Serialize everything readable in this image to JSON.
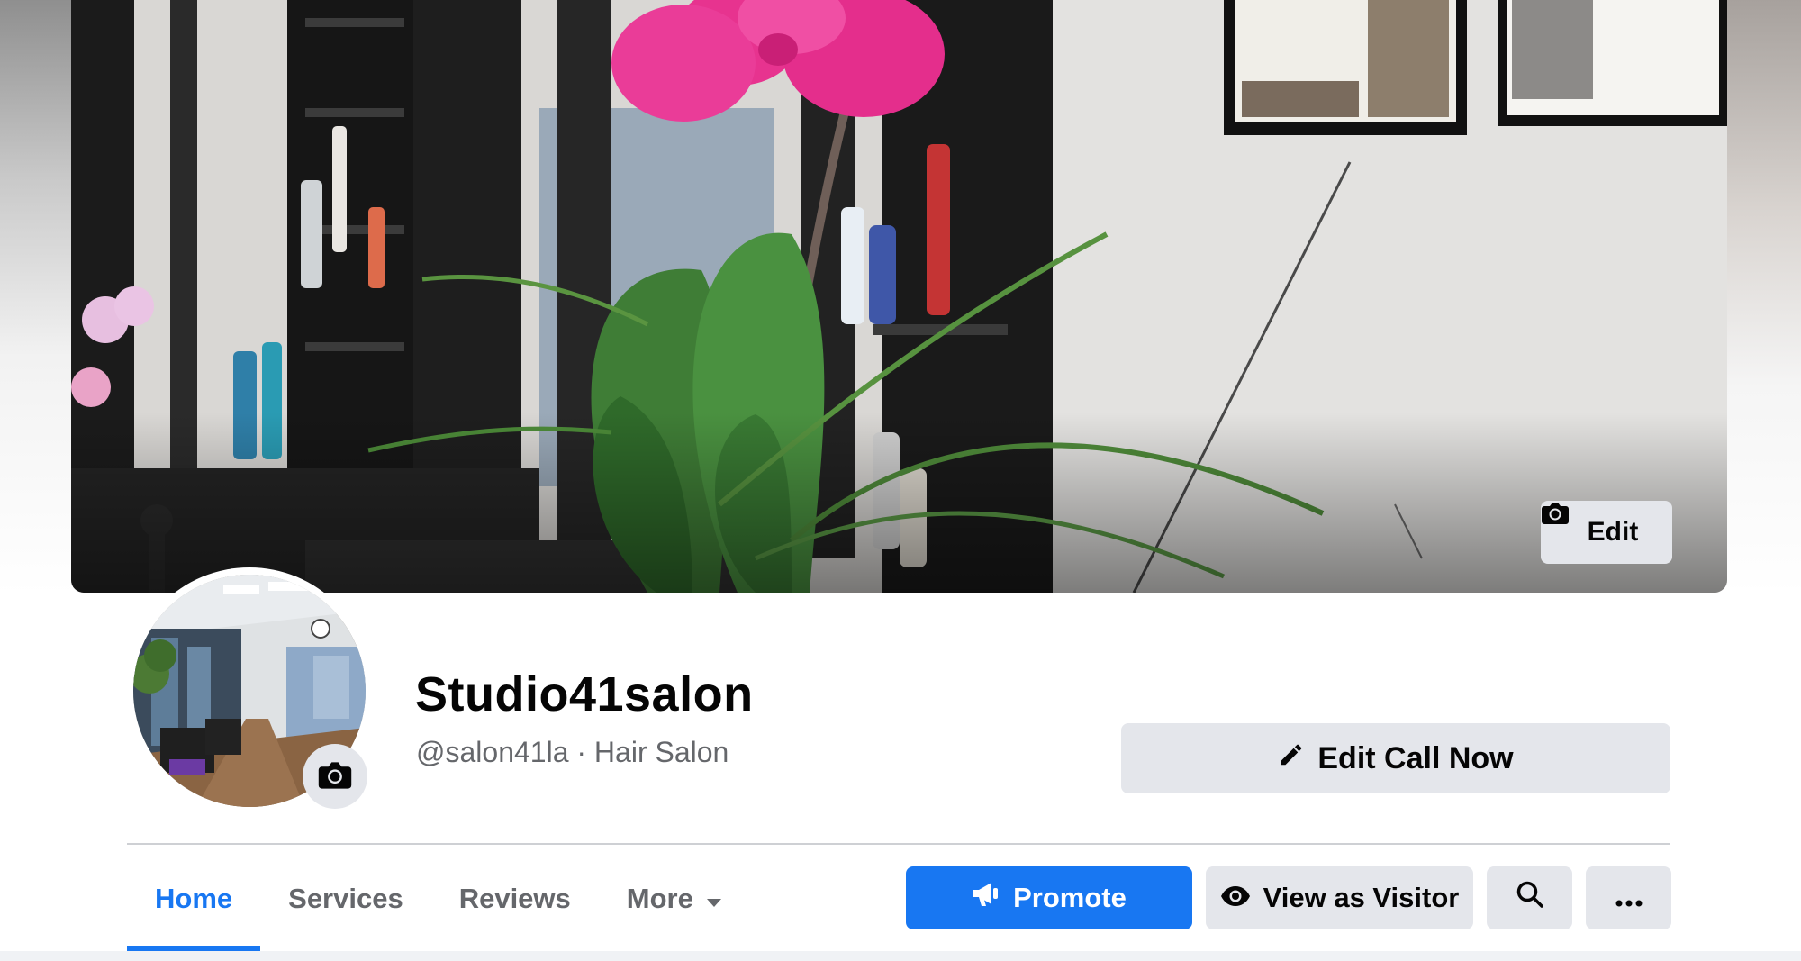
{
  "cover": {
    "edit_label": "Edit",
    "camera_icon": "camera-icon"
  },
  "profile": {
    "name": "Studio41salon",
    "subtitle": "@salon41la · Hair Salon",
    "edit_call_label": "Edit Call Now",
    "pencil_icon": "pencil-icon"
  },
  "tabs": [
    {
      "label": "Home",
      "active": true
    },
    {
      "label": "Services",
      "active": false
    },
    {
      "label": "Reviews",
      "active": false
    },
    {
      "label": "More",
      "active": false,
      "icon": "caret-down-icon"
    }
  ],
  "actions": {
    "promote_label": "Promote",
    "promote_icon": "megaphone-icon",
    "visitor_label": "View as Visitor",
    "visitor_icon": "eye-icon",
    "search_icon": "search-icon",
    "more_icon": "ellipsis-icon"
  },
  "colors": {
    "accent": "#1877f2",
    "button_grey": "#e4e6eb",
    "text_primary": "#050505",
    "text_secondary": "#65676b"
  }
}
